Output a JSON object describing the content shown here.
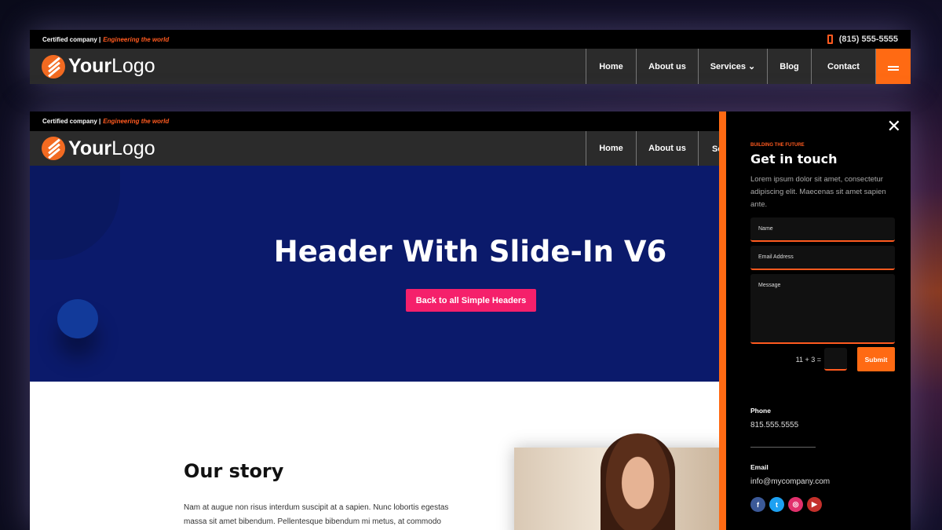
{
  "header": {
    "certified": "Certified company |",
    "tagline": "Engineering the world",
    "phone": "(815) 555-5555",
    "logo_bold": "Your",
    "logo_light": "Logo",
    "menu": [
      "Home",
      "About us",
      "Services ⌄",
      "Blog",
      "Contact"
    ]
  },
  "hero": {
    "title": "Header With Slide-In V6",
    "button": "Back to all Simple Headers"
  },
  "content": {
    "heading": "Our story",
    "text": "Nam at augue non risus interdum suscipit at a sapien. Nunc lobortis egestas massa sit amet bibendum. Pellentesque bibendum mi metus, at commodo"
  },
  "panel": {
    "kicker": "BUILDING THE FUTURE",
    "title": "Get in touch",
    "lead": "Lorem ipsum dolor sit amet, consectetur adipiscing elit. Maecenas sit amet sapien ante.",
    "name_placeholder": "Name",
    "email_placeholder": "Email Address",
    "message_placeholder": "Message",
    "captcha": "11 + 3 =",
    "submit": "Submit",
    "phone_label": "Phone",
    "phone": "815.555.5555",
    "email_label": "Email",
    "email": "info@mycompany.com"
  },
  "colors": {
    "accent": "#ff6a13",
    "hero": "#0b1a6b",
    "cta": "#f5206b"
  },
  "social": [
    {
      "icon": "facebook-icon",
      "glyph": "f",
      "color": "#3b5998"
    },
    {
      "icon": "twitter-icon",
      "glyph": "t",
      "color": "#1da1f2"
    },
    {
      "icon": "instagram-icon",
      "glyph": "◎",
      "color": "#e1306c"
    },
    {
      "icon": "youtube-icon",
      "glyph": "▶",
      "color": "#c4302b"
    }
  ]
}
